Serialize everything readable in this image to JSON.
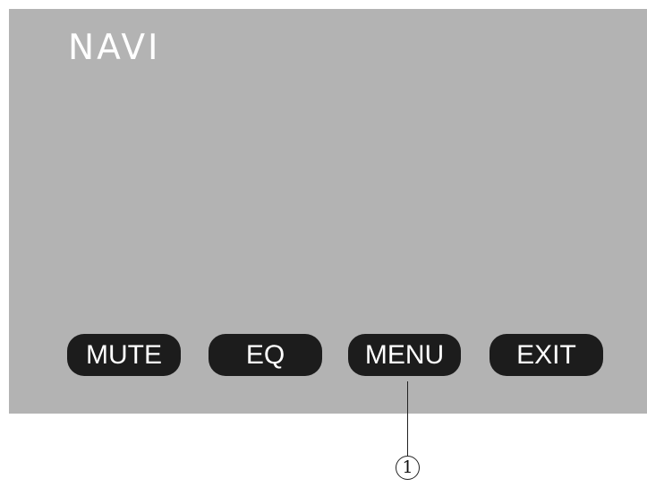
{
  "screen": {
    "title": "NAVI",
    "background_color": "#b3b3b3",
    "buttons": [
      {
        "label": "MUTE"
      },
      {
        "label": "EQ"
      },
      {
        "label": "MENU"
      },
      {
        "label": "EXIT"
      }
    ]
  },
  "callout": {
    "number": "1",
    "target": "MENU"
  },
  "colors": {
    "button_bg": "#1c1c1c",
    "button_text": "#ffffff",
    "title_text": "#ffffff"
  }
}
